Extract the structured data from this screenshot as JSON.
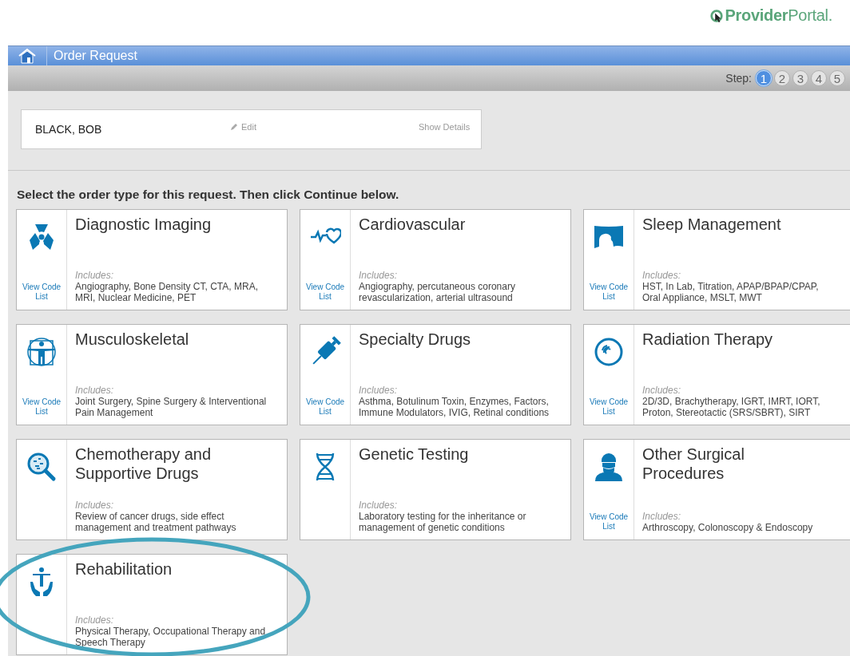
{
  "logo": {
    "text": "**Provider**Portal."
  },
  "header": {
    "title": "Order Request"
  },
  "steps": {
    "label": "Step:",
    "items": [
      {
        "number": "1",
        "selected": true
      },
      {
        "number": "2",
        "selected": false
      },
      {
        "number": "3",
        "selected": false
      },
      {
        "number": "4",
        "selected": false
      },
      {
        "number": "5",
        "selected": false
      }
    ]
  },
  "patient": {
    "name": "BLACK, BOB",
    "edit": "Edit",
    "details": "Show Details"
  },
  "instruction": "Select the order type for this request. Then click Continue below.",
  "cards": [
    {
      "kind": "radiation",
      "title": "Diagnostic Imaging",
      "link": "View Code List",
      "includes_label": "Includes:",
      "includes": "Angiography, Bone Density CT, CTA, MRA, MRI, Nuclear Medicine, PET"
    },
    {
      "kind": "heart",
      "title": "Cardiovascular",
      "link": "View Code List",
      "includes_label": "Includes:",
      "includes": "Angiography, percutaneous coronary revascularization, arterial ultrasound"
    },
    {
      "kind": "sleep",
      "title": "Sleep Management",
      "link": "View Code List",
      "includes_label": "Includes:",
      "includes": "HST, In Lab, Titration, APAP/BPAP/CPAP, Oral Appliance, MSLT, MWT"
    },
    {
      "kind": "figure",
      "title": "Musculoskeletal",
      "link": "View Code List",
      "includes_label": "Includes:",
      "includes": "Joint Surgery, Spine Surgery & Interventional Pain Management"
    },
    {
      "kind": "syringe",
      "title": "Specialty Drugs",
      "link": "View Code List",
      "includes_label": "Includes:",
      "includes": "Asthma, Botulinum Toxin, Enzymes, Factors, Immune Modulators, IVIG, Retinal conditions"
    },
    {
      "kind": "target",
      "title": "Radiation Therapy",
      "link": "View Code List",
      "includes_label": "Includes:",
      "includes": "2D/3D, Brachytherapy, IGRT, IMRT, IORT, Proton, Stereotactic (SRS/SBRT), SIRT"
    },
    {
      "kind": "magnifier",
      "title": "Chemotherapy and Supportive Drugs",
      "includes_label": "Includes:",
      "includes": "Review of cancer drugs, side effect management and treatment pathways"
    },
    {
      "kind": "dna",
      "title": "Genetic Testing",
      "includes_label": "Includes:",
      "includes": "Laboratory testing for the inheritance or management of genetic conditions"
    },
    {
      "kind": "surgeon",
      "title": "Other Surgical Procedures",
      "link": "View Code List",
      "includes_label": "Includes:",
      "includes": "Arthroscopy, Colonoscopy & Endoscopy"
    },
    {
      "kind": "rehab",
      "title": "Rehabilitation",
      "includes_label": "Includes:",
      "includes": "Physical Therapy, Occupational Therapy and Speech Therapy"
    }
  ]
}
